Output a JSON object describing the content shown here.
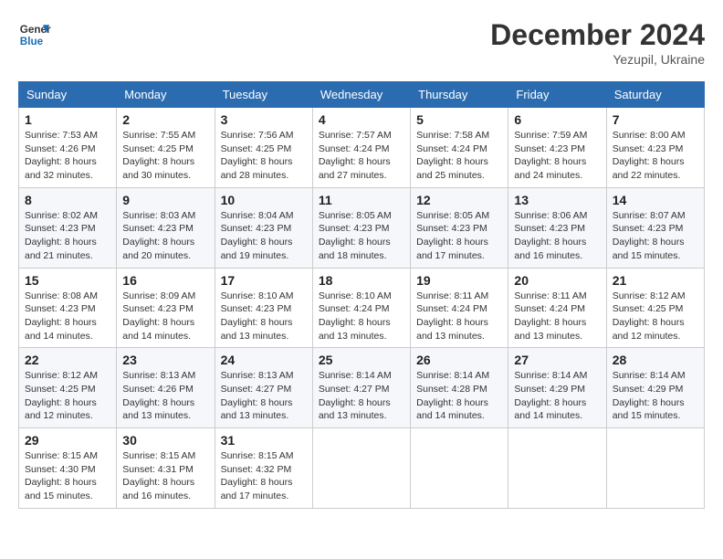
{
  "logo": {
    "line1": "General",
    "line2": "Blue"
  },
  "title": "December 2024",
  "subtitle": "Yezupil, Ukraine",
  "days_header": [
    "Sunday",
    "Monday",
    "Tuesday",
    "Wednesday",
    "Thursday",
    "Friday",
    "Saturday"
  ],
  "weeks": [
    [
      {
        "day": "1",
        "sunrise": "7:53 AM",
        "sunset": "4:26 PM",
        "daylight": "8 hours and 32 minutes."
      },
      {
        "day": "2",
        "sunrise": "7:55 AM",
        "sunset": "4:25 PM",
        "daylight": "8 hours and 30 minutes."
      },
      {
        "day": "3",
        "sunrise": "7:56 AM",
        "sunset": "4:25 PM",
        "daylight": "8 hours and 28 minutes."
      },
      {
        "day": "4",
        "sunrise": "7:57 AM",
        "sunset": "4:24 PM",
        "daylight": "8 hours and 27 minutes."
      },
      {
        "day": "5",
        "sunrise": "7:58 AM",
        "sunset": "4:24 PM",
        "daylight": "8 hours and 25 minutes."
      },
      {
        "day": "6",
        "sunrise": "7:59 AM",
        "sunset": "4:23 PM",
        "daylight": "8 hours and 24 minutes."
      },
      {
        "day": "7",
        "sunrise": "8:00 AM",
        "sunset": "4:23 PM",
        "daylight": "8 hours and 22 minutes."
      }
    ],
    [
      {
        "day": "8",
        "sunrise": "8:02 AM",
        "sunset": "4:23 PM",
        "daylight": "8 hours and 21 minutes."
      },
      {
        "day": "9",
        "sunrise": "8:03 AM",
        "sunset": "4:23 PM",
        "daylight": "8 hours and 20 minutes."
      },
      {
        "day": "10",
        "sunrise": "8:04 AM",
        "sunset": "4:23 PM",
        "daylight": "8 hours and 19 minutes."
      },
      {
        "day": "11",
        "sunrise": "8:05 AM",
        "sunset": "4:23 PM",
        "daylight": "8 hours and 18 minutes."
      },
      {
        "day": "12",
        "sunrise": "8:05 AM",
        "sunset": "4:23 PM",
        "daylight": "8 hours and 17 minutes."
      },
      {
        "day": "13",
        "sunrise": "8:06 AM",
        "sunset": "4:23 PM",
        "daylight": "8 hours and 16 minutes."
      },
      {
        "day": "14",
        "sunrise": "8:07 AM",
        "sunset": "4:23 PM",
        "daylight": "8 hours and 15 minutes."
      }
    ],
    [
      {
        "day": "15",
        "sunrise": "8:08 AM",
        "sunset": "4:23 PM",
        "daylight": "8 hours and 14 minutes."
      },
      {
        "day": "16",
        "sunrise": "8:09 AM",
        "sunset": "4:23 PM",
        "daylight": "8 hours and 14 minutes."
      },
      {
        "day": "17",
        "sunrise": "8:10 AM",
        "sunset": "4:23 PM",
        "daylight": "8 hours and 13 minutes."
      },
      {
        "day": "18",
        "sunrise": "8:10 AM",
        "sunset": "4:24 PM",
        "daylight": "8 hours and 13 minutes."
      },
      {
        "day": "19",
        "sunrise": "8:11 AM",
        "sunset": "4:24 PM",
        "daylight": "8 hours and 13 minutes."
      },
      {
        "day": "20",
        "sunrise": "8:11 AM",
        "sunset": "4:24 PM",
        "daylight": "8 hours and 13 minutes."
      },
      {
        "day": "21",
        "sunrise": "8:12 AM",
        "sunset": "4:25 PM",
        "daylight": "8 hours and 12 minutes."
      }
    ],
    [
      {
        "day": "22",
        "sunrise": "8:12 AM",
        "sunset": "4:25 PM",
        "daylight": "8 hours and 12 minutes."
      },
      {
        "day": "23",
        "sunrise": "8:13 AM",
        "sunset": "4:26 PM",
        "daylight": "8 hours and 13 minutes."
      },
      {
        "day": "24",
        "sunrise": "8:13 AM",
        "sunset": "4:27 PM",
        "daylight": "8 hours and 13 minutes."
      },
      {
        "day": "25",
        "sunrise": "8:14 AM",
        "sunset": "4:27 PM",
        "daylight": "8 hours and 13 minutes."
      },
      {
        "day": "26",
        "sunrise": "8:14 AM",
        "sunset": "4:28 PM",
        "daylight": "8 hours and 14 minutes."
      },
      {
        "day": "27",
        "sunrise": "8:14 AM",
        "sunset": "4:29 PM",
        "daylight": "8 hours and 14 minutes."
      },
      {
        "day": "28",
        "sunrise": "8:14 AM",
        "sunset": "4:29 PM",
        "daylight": "8 hours and 15 minutes."
      }
    ],
    [
      {
        "day": "29",
        "sunrise": "8:15 AM",
        "sunset": "4:30 PM",
        "daylight": "8 hours and 15 minutes."
      },
      {
        "day": "30",
        "sunrise": "8:15 AM",
        "sunset": "4:31 PM",
        "daylight": "8 hours and 16 minutes."
      },
      {
        "day": "31",
        "sunrise": "8:15 AM",
        "sunset": "4:32 PM",
        "daylight": "8 hours and 17 minutes."
      },
      null,
      null,
      null,
      null
    ]
  ],
  "labels": {
    "sunrise": "Sunrise:",
    "sunset": "Sunset:",
    "daylight": "Daylight:"
  }
}
